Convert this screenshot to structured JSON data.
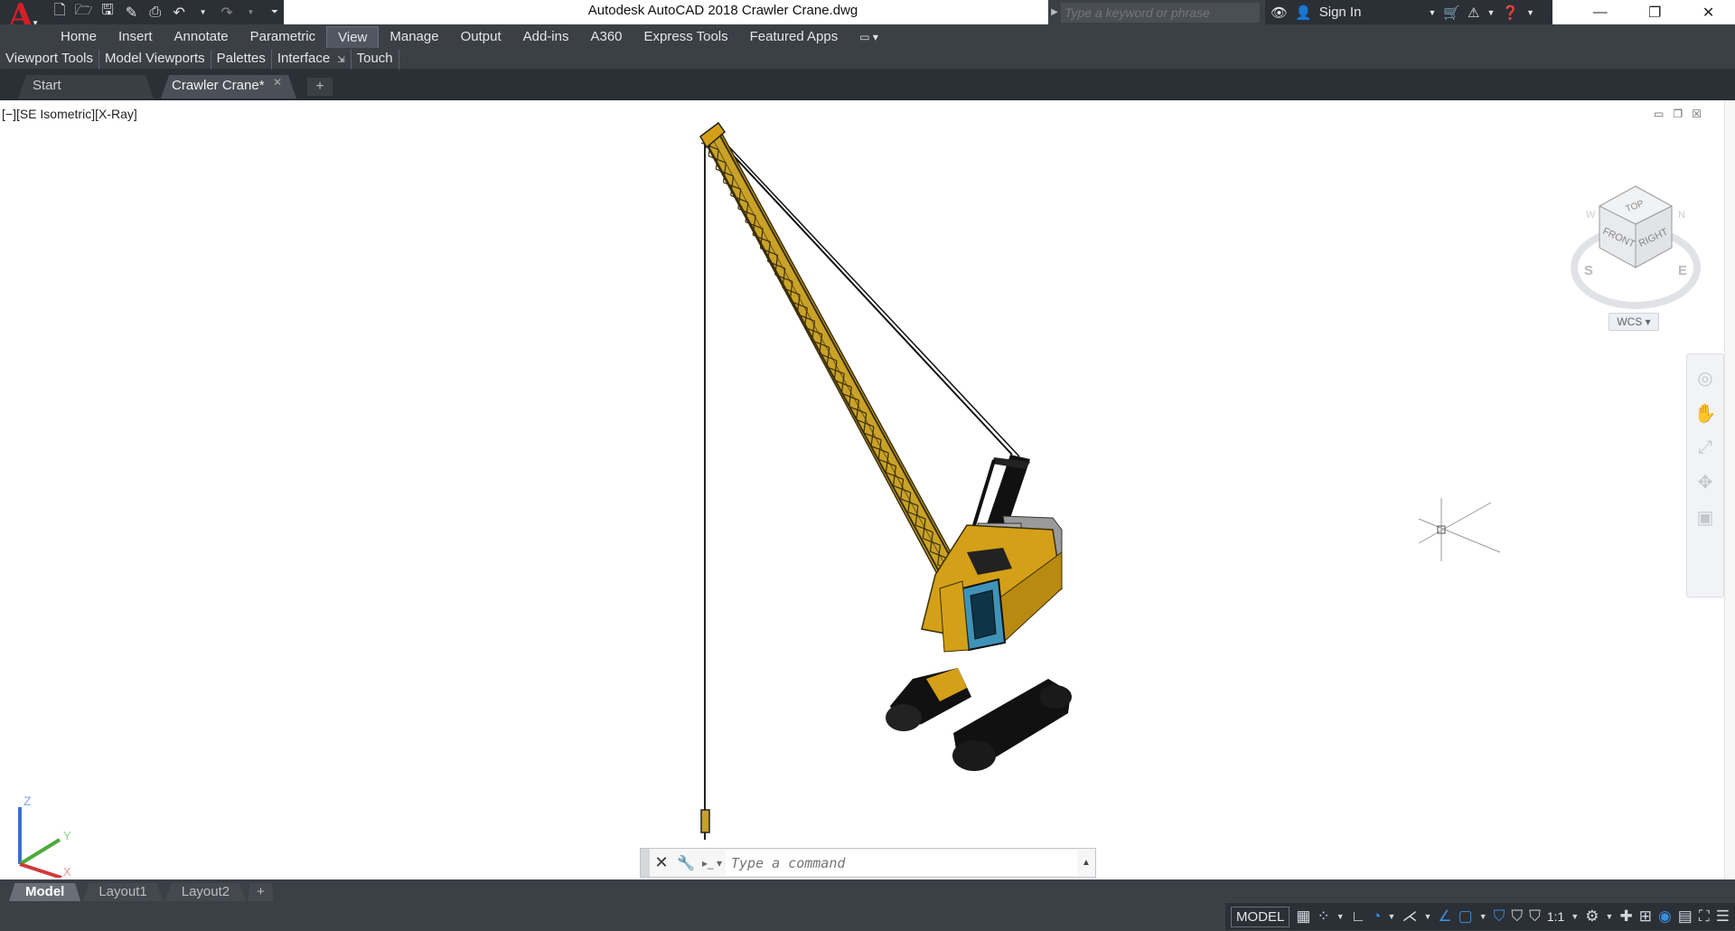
{
  "app": {
    "title": "Autodesk AutoCAD 2018   Crawler Crane.dwg",
    "logo_letter": "A"
  },
  "search": {
    "placeholder": "Type a keyword or phrase"
  },
  "user": {
    "sign_in": "Sign In"
  },
  "ribbon": {
    "tabs": [
      "Home",
      "Insert",
      "Annotate",
      "Parametric",
      "View",
      "Manage",
      "Output",
      "Add-ins",
      "A360",
      "Express Tools",
      "Featured Apps"
    ],
    "active_tab": "View",
    "panels": [
      "Viewport Tools",
      "Model Viewports",
      "Palettes",
      "Interface",
      "Touch"
    ]
  },
  "file_tabs": {
    "start": "Start",
    "current": "Crawler Crane*"
  },
  "viewport": {
    "label": "[−][SE Isometric][X-Ray]",
    "viewcube": {
      "top": "TOP",
      "front": "FRONT",
      "right": "RIGHT",
      "compass_s": "S",
      "compass_e": "E",
      "compass_w": "W",
      "compass_n": "N"
    },
    "wcs": "WCS"
  },
  "ucs": {
    "z": "Z",
    "y": "Y",
    "x": "X"
  },
  "command": {
    "placeholder": "Type a command"
  },
  "layout_tabs": {
    "items": [
      "Model",
      "Layout1",
      "Layout2"
    ],
    "active": "Model"
  },
  "status": {
    "model": "MODEL",
    "scale": "1:1"
  },
  "colors": {
    "dark_chrome": "#2b2f36",
    "ribbon": "#3b3f46",
    "crane_yellow": "#d4a017",
    "cab_blue": "#3f93b8",
    "accent_blue": "#3a8fdc"
  }
}
